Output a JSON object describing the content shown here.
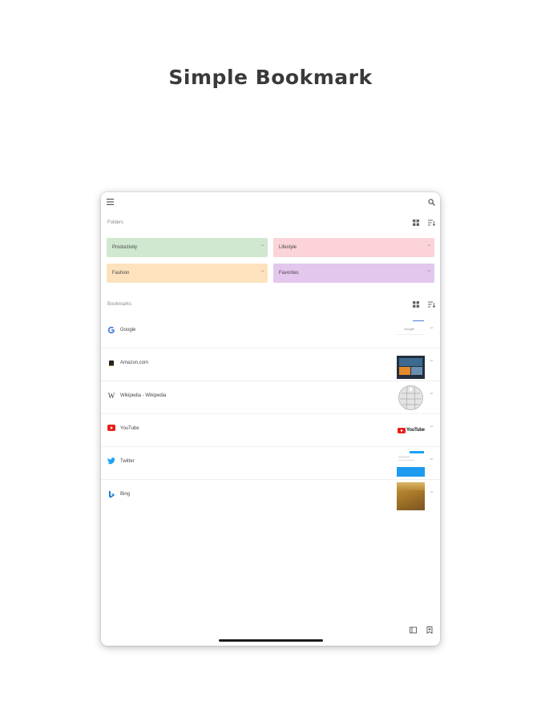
{
  "headline": "Simple Bookmark",
  "toolbar": {
    "menu_icon": "menu-icon",
    "search_icon": "search-icon"
  },
  "folders": {
    "label": "Folders",
    "items": [
      {
        "name": "Productivity",
        "color": "#cfe8cf"
      },
      {
        "name": "Lifestyle",
        "color": "#fbd3d8"
      },
      {
        "name": "Fashion",
        "color": "#fde3bd"
      },
      {
        "name": "Favorites",
        "color": "#e3c7ec"
      }
    ]
  },
  "bookmarks": {
    "label": "Bookmarks",
    "items": [
      {
        "title": "Google",
        "icon": "google-icon"
      },
      {
        "title": "Amazon.com",
        "icon": "amazon-icon"
      },
      {
        "title": "Wikipedia - Wikipedia",
        "icon": "wikipedia-icon"
      },
      {
        "title": "YouTube",
        "icon": "youtube-icon"
      },
      {
        "title": "Twitter",
        "icon": "twitter-icon"
      },
      {
        "title": "Bing",
        "icon": "bing-icon"
      }
    ],
    "thumb_texts": {
      "google": "Google",
      "youtube": "YouTube"
    }
  },
  "bottom_bar": {
    "left_icon": "import-icon",
    "right_icon": "bookmark-add-icon"
  }
}
